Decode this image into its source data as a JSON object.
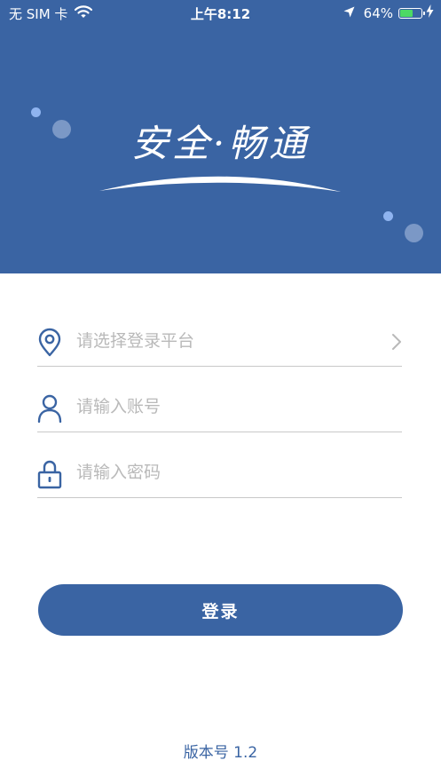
{
  "status_bar": {
    "carrier": "无 SIM 卡",
    "time": "上午8:12",
    "battery_percent": "64%",
    "battery_level": 0.64
  },
  "header": {
    "brand_slogan": "安全·畅通"
  },
  "form": {
    "platform_placeholder": "请选择登录平台",
    "account_placeholder": "请输入账号",
    "password_placeholder": "请输入密码"
  },
  "login_button": {
    "label": "登录"
  },
  "footer": {
    "version": "版本号 1.2"
  },
  "colors": {
    "primary": "#3a64a3",
    "divider": "#c8c8c8",
    "placeholder": "#b9b9b9",
    "battery_fill": "#4cd964",
    "bubble_light": "#8fb4f0",
    "bubble_muted": "#7b98c6"
  },
  "icons": [
    "wifi-icon",
    "location-arrow-icon",
    "battery-icon",
    "charging-icon",
    "location-pin-icon",
    "user-icon",
    "lock-icon",
    "chevron-right-icon"
  ]
}
